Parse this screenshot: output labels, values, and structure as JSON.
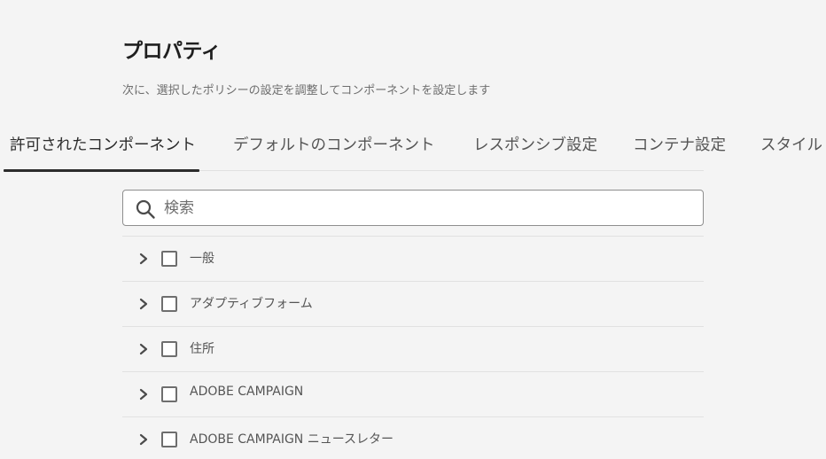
{
  "page": {
    "title": "プロパティ",
    "subtitle": "次に、選択したポリシーの設定を調整してコンポーネントを設定します"
  },
  "tabs": [
    {
      "label": "許可されたコンポーネント",
      "active": true
    },
    {
      "label": "デフォルトのコンポーネント",
      "active": false
    },
    {
      "label": "レスポンシブ設定",
      "active": false
    },
    {
      "label": "コンテナ設定",
      "active": false
    },
    {
      "label": "スタイル",
      "active": false
    }
  ],
  "search": {
    "placeholder": "検索",
    "value": ""
  },
  "component_groups": [
    {
      "label": "一般",
      "checked": false,
      "expanded": false
    },
    {
      "label": "アダプティブフォーム",
      "checked": false,
      "expanded": false
    },
    {
      "label": "住所",
      "checked": false,
      "expanded": false
    },
    {
      "label": "ADOBE CAMPAIGN",
      "checked": false,
      "expanded": false
    },
    {
      "label": "ADOBE CAMPAIGN ニュースレター",
      "checked": false,
      "expanded": false
    }
  ],
  "icons": {
    "search": "search-icon",
    "expand": "chevron-right-icon"
  }
}
